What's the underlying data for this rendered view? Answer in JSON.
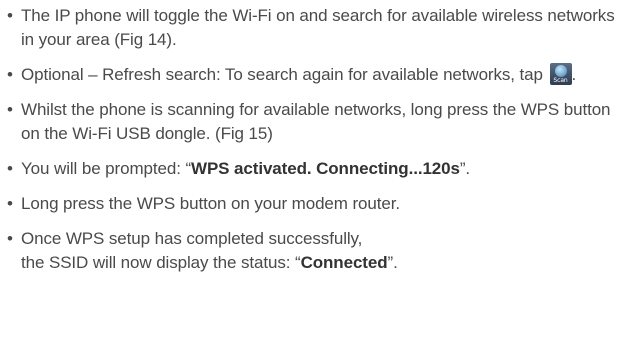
{
  "bullets": [
    {
      "text": "The IP phone will toggle the Wi-Fi on and search for available wireless networks in your area (Fig 14)."
    },
    {
      "text": "Optional – Refresh search: To search again for available networks, tap",
      "icon": "scan-icon",
      "icon_label": "Scan",
      "after_icon": "."
    },
    {
      "text": "Whilst the phone is scanning for available networks, long press the WPS button on the Wi-Fi USB dongle. (Fig 15)"
    },
    {
      "before": "You will be prompted: “",
      "bold": "WPS activated. Connecting...120s",
      "after": "”."
    },
    {
      "text": "Long press the WPS button on your modem router."
    },
    {
      "line1": "Once WPS setup has completed successfully,",
      "before": "the SSID will now display the status: “",
      "bold": "Connected",
      "after": "”."
    }
  ],
  "bullet_glyph": "•",
  "colors": {
    "text": "#4a4a4a",
    "bold_text": "#333333"
  }
}
